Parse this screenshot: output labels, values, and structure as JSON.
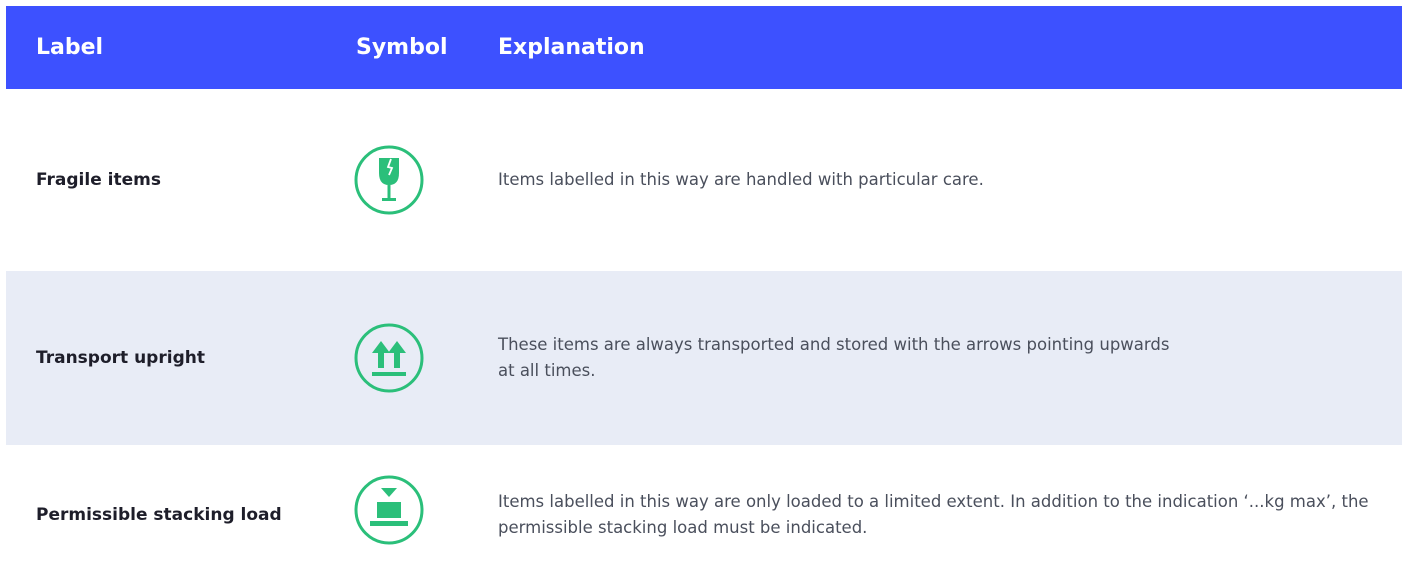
{
  "colors": {
    "header_bg": "#3d51ff",
    "row_alt_bg": "#e8ecf6",
    "icon_green": "#2bbf7a"
  },
  "header": {
    "label": "Label",
    "symbol": "Symbol",
    "explanation": "Explanation"
  },
  "rows": [
    {
      "label": "Fragile items",
      "icon": "fragile-glass-icon",
      "explanation": "Items labelled in this way are handled with particular care."
    },
    {
      "label": "Transport upright",
      "icon": "arrows-up-icon",
      "explanation": "These items are always transported and stored with the arrows pointing upwards at all times."
    },
    {
      "label": "Permissible stacking load",
      "icon": "stacking-load-icon",
      "explanation": "Items labelled in this way are only loaded to a limited extent. In addition to the indication ‘...kg max’, the permissible stacking load must be indicated."
    }
  ]
}
